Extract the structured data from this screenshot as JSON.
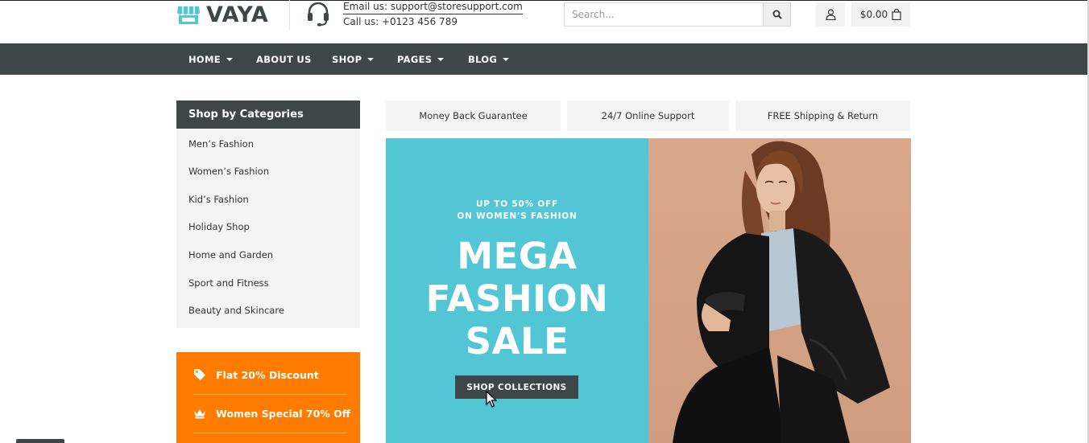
{
  "header": {
    "logo_text": "VAYA",
    "email_line": "Email us: support@storesupport.com",
    "phone_line": "Call us: +0123 456 789",
    "search_placeholder": "Search...",
    "cart_total": "$0.00"
  },
  "nav": {
    "items": [
      {
        "label": "HOME",
        "has_dropdown": true
      },
      {
        "label": "ABOUT US",
        "has_dropdown": false
      },
      {
        "label": "SHOP",
        "has_dropdown": true
      },
      {
        "label": "PAGES",
        "has_dropdown": true
      },
      {
        "label": "BLOG",
        "has_dropdown": true
      }
    ]
  },
  "sidebar": {
    "title": "Shop by Categories",
    "categories": [
      "Men’s Fashion",
      "Women’s Fashion",
      "Kid’s Fashion",
      "Holiday Shop",
      "Home and Garden",
      "Sport and Fitness",
      "Beauty and Skincare"
    ]
  },
  "promo": {
    "items": [
      {
        "label": "Flat 20% Discount",
        "icon": "tag-icon"
      },
      {
        "label": "Women Special 70% Off",
        "icon": "crown-icon"
      }
    ]
  },
  "features": [
    "Money Back Guarantee",
    "24/7 Online Support",
    "FREE Shipping & Return"
  ],
  "hero": {
    "subtitle_line1": "UP TO 50% OFF",
    "subtitle_line2": "ON WOMEN'S FASHION",
    "title_line1": "MEGA",
    "title_line2": "FASHION",
    "title_line3": "SALE",
    "button_label": "SHOP COLLECTIONS"
  },
  "colors": {
    "brand_dark": "#3d4748",
    "accent_teal": "#53c6d6",
    "accent_orange": "#ff7c00",
    "panel_gray": "#f4f4f4",
    "hero_photo_bg": "#d2a284"
  }
}
